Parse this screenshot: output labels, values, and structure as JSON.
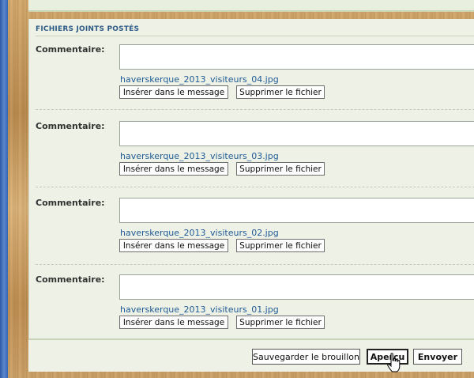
{
  "section_title": "FICHIERS JOINTS POSTÉS",
  "attachments": [
    {
      "label": "Commentaire:",
      "filename": "haverskerque_2013_visiteurs_04.jpg",
      "insert_label": "Insérer dans le message",
      "delete_label": "Supprimer le fichier"
    },
    {
      "label": "Commentaire:",
      "filename": "haverskerque_2013_visiteurs_03.jpg",
      "insert_label": "Insérer dans le message",
      "delete_label": "Supprimer le fichier"
    },
    {
      "label": "Commentaire:",
      "filename": "haverskerque_2013_visiteurs_02.jpg",
      "insert_label": "Insérer dans le message",
      "delete_label": "Supprimer le fichier"
    },
    {
      "label": "Commentaire:",
      "filename": "haverskerque_2013_visiteurs_01.jpg",
      "insert_label": "Insérer dans le message",
      "delete_label": "Supprimer le fichier"
    }
  ],
  "footer": {
    "save_label": "Sauvegarder le brouillon",
    "preview_label": "Aperçu",
    "send_label": "Envoyer"
  },
  "icons": {
    "cursor": "hand-pointer-icon"
  },
  "colors": {
    "panel_bg": "#eef2e6",
    "title": "#2f5c86",
    "link": "#1f5a96"
  }
}
